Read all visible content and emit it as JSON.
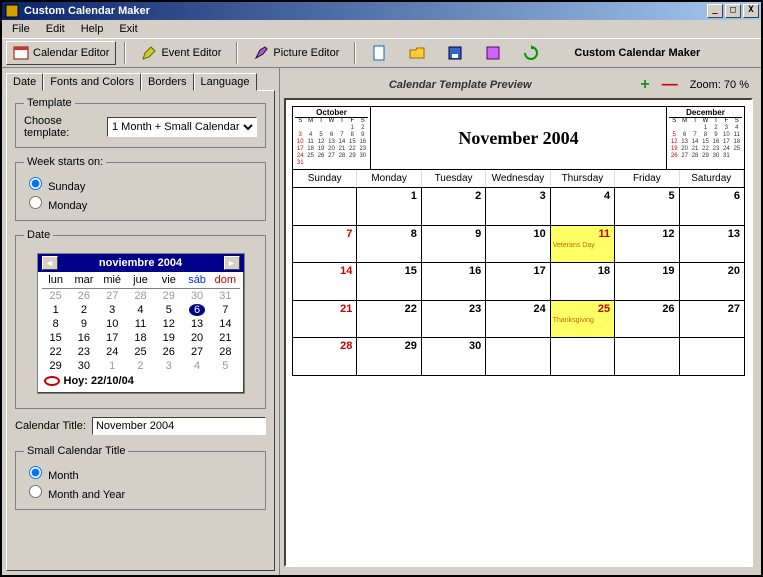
{
  "window": {
    "title": "Custom Calendar Maker"
  },
  "menu": {
    "file": "File",
    "edit": "Edit",
    "help": "Help",
    "exit": "Exit"
  },
  "toolbar": {
    "calendar_editor": "Calendar Editor",
    "event_editor": "Event Editor",
    "picture_editor": "Picture Editor",
    "app_name": "Custom Calendar Maker"
  },
  "tabs": {
    "date": "Date",
    "fonts": "Fonts and Colors",
    "borders": "Borders",
    "language": "Language"
  },
  "template": {
    "legend": "Template",
    "choose_label": "Choose template:",
    "choose_value": "1 Month + Small Calendar"
  },
  "weekstart": {
    "legend": "Week starts on:",
    "sunday": "Sunday",
    "monday": "Monday",
    "selected": "sunday"
  },
  "date_legend": "Date",
  "minical": {
    "title": "noviembre 2004",
    "dayheaders": [
      "lun",
      "mar",
      "mié",
      "jue",
      "vie",
      "sáb",
      "dom"
    ],
    "rows": [
      [
        "25",
        "26",
        "27",
        "28",
        "29",
        "30",
        "31"
      ],
      [
        "1",
        "2",
        "3",
        "4",
        "5",
        "6",
        "7"
      ],
      [
        "8",
        "9",
        "10",
        "11",
        "12",
        "13",
        "14"
      ],
      [
        "15",
        "16",
        "17",
        "18",
        "19",
        "20",
        "21"
      ],
      [
        "22",
        "23",
        "24",
        "25",
        "26",
        "27",
        "28"
      ],
      [
        "29",
        "30",
        "1",
        "2",
        "3",
        "4",
        "5"
      ]
    ],
    "today": "Hoy: 22/10/04"
  },
  "cal_title": {
    "label": "Calendar Title:",
    "value": "November 2004"
  },
  "smalltitle": {
    "legend": "Small Calendar Title",
    "month": "Month",
    "monthyear": "Month and Year",
    "selected": "month"
  },
  "preview": {
    "bar_title": "Calendar Template Preview",
    "zoom": "Zoom: 70 %",
    "main_title": "November 2004",
    "dayheaders": [
      "Sunday",
      "Monday",
      "Tuesday",
      "Wednesday",
      "Thursday",
      "Friday",
      "Saturday"
    ],
    "prev": {
      "title": "October",
      "hdr": [
        "S",
        "M",
        "T",
        "W",
        "T",
        "F",
        "S"
      ],
      "rows": [
        [
          "",
          "",
          "",
          "",
          "",
          "1",
          "2"
        ],
        [
          "3",
          "4",
          "5",
          "6",
          "7",
          "8",
          "9"
        ],
        [
          "10",
          "11",
          "12",
          "13",
          "14",
          "15",
          "16"
        ],
        [
          "17",
          "18",
          "19",
          "20",
          "21",
          "22",
          "23"
        ],
        [
          "24",
          "25",
          "26",
          "27",
          "28",
          "29",
          "30"
        ],
        [
          "31",
          "",
          "",
          "",
          "",
          "",
          ""
        ]
      ]
    },
    "next": {
      "title": "December",
      "hdr": [
        "S",
        "M",
        "T",
        "W",
        "T",
        "F",
        "S"
      ],
      "rows": [
        [
          "",
          "",
          "",
          "1",
          "2",
          "3",
          "4"
        ],
        [
          "5",
          "6",
          "7",
          "8",
          "9",
          "10",
          "11"
        ],
        [
          "12",
          "13",
          "14",
          "15",
          "16",
          "17",
          "18"
        ],
        [
          "19",
          "20",
          "21",
          "22",
          "23",
          "24",
          "25"
        ],
        [
          "26",
          "27",
          "28",
          "29",
          "30",
          "31",
          ""
        ]
      ]
    },
    "cells": [
      {
        "n": "",
        "red": false
      },
      {
        "n": "1"
      },
      {
        "n": "2"
      },
      {
        "n": "3"
      },
      {
        "n": "4"
      },
      {
        "n": "5"
      },
      {
        "n": "6"
      },
      {
        "n": "7",
        "red": true
      },
      {
        "n": "8"
      },
      {
        "n": "9"
      },
      {
        "n": "10"
      },
      {
        "n": "11",
        "red": true,
        "hl": true,
        "ev": "Veterans Day"
      },
      {
        "n": "12"
      },
      {
        "n": "13"
      },
      {
        "n": "14",
        "red": true
      },
      {
        "n": "15"
      },
      {
        "n": "16"
      },
      {
        "n": "17"
      },
      {
        "n": "18"
      },
      {
        "n": "19"
      },
      {
        "n": "20"
      },
      {
        "n": "21",
        "red": true
      },
      {
        "n": "22"
      },
      {
        "n": "23"
      },
      {
        "n": "24"
      },
      {
        "n": "25",
        "red": true,
        "hl": true,
        "ev": "Thanksgiving"
      },
      {
        "n": "26"
      },
      {
        "n": "27"
      },
      {
        "n": "28",
        "red": true
      },
      {
        "n": "29"
      },
      {
        "n": "30"
      },
      {
        "n": ""
      },
      {
        "n": ""
      },
      {
        "n": ""
      },
      {
        "n": ""
      }
    ]
  }
}
